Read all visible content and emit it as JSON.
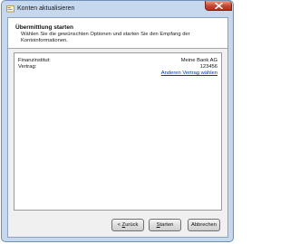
{
  "window": {
    "title": "Konten aktualisieren",
    "close_glyph": "✕",
    "accent_color": "#c5d8ee"
  },
  "header": {
    "title": "Übermittlung starten",
    "description": "Wählen Sie die gewünschten Optionen und starten Sie den Empfang der Kontoinformationen."
  },
  "fields": {
    "institute_label": "Finanzinstitut:",
    "institute_value": "Meine Bank AG",
    "contract_label": "Vertrag:",
    "contract_value": "123456",
    "change_contract_link": "Anderen Vertrag wählen"
  },
  "buttons": {
    "back_arrow": "<",
    "back_accel": "Z",
    "back_rest": "urück",
    "start_accel": "S",
    "start_rest": "tarten",
    "cancel_label": "Abbrechen"
  },
  "icons": {
    "app": "bank-account-icon",
    "close": "close-icon"
  }
}
